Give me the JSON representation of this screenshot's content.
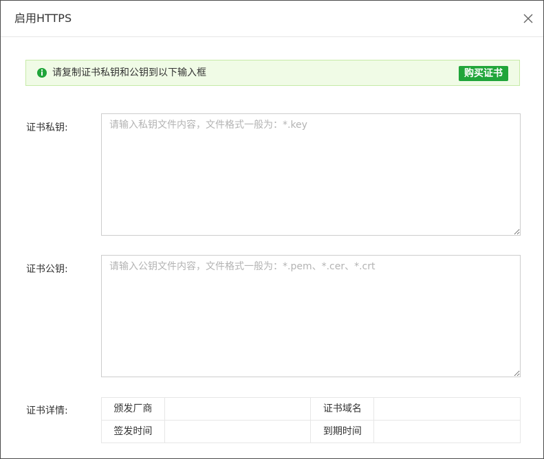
{
  "dialog": {
    "title": "启用HTTPS",
    "close_label": "×"
  },
  "notice": {
    "text": "请复制证书私钥和公钥到以下输入框",
    "buy_label": "购买证书"
  },
  "private_key": {
    "label": "证书私钥:",
    "placeholder": "请输入私钥文件内容，文件格式一般为：*.key",
    "value": ""
  },
  "public_key": {
    "label": "证书公钥:",
    "placeholder": "请输入公钥文件内容，文件格式一般为：*.pem、*.cer、*.crt",
    "value": ""
  },
  "details": {
    "label": "证书详情:",
    "issuer_label": "颁发厂商",
    "issuer_value": "",
    "domain_label": "证书域名",
    "domain_value": "",
    "issued_label": "签发时间",
    "issued_value": "",
    "expiry_label": "到期时间",
    "expiry_value": ""
  },
  "colors": {
    "accent": "#20a53a",
    "notice_bg": "#f0fbe6",
    "notice_border": "#c6eaa6",
    "border": "#cccccc"
  },
  "icons": {
    "close": "close-icon",
    "info": "info-icon"
  }
}
